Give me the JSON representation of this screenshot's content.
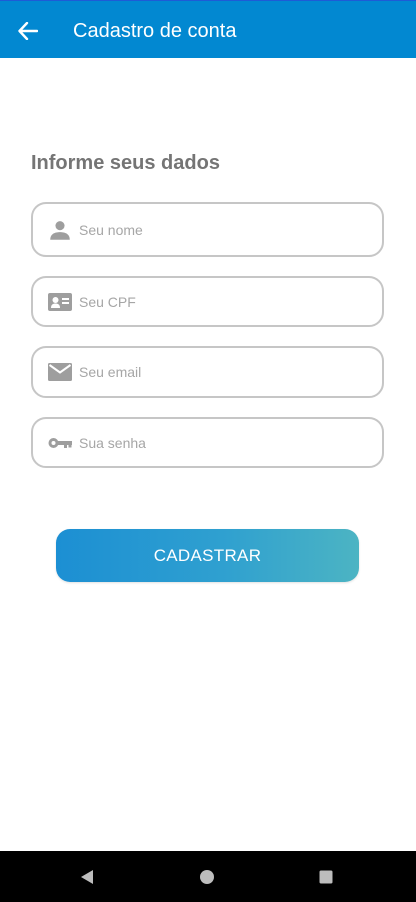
{
  "header": {
    "title": "Cadastro de conta",
    "back_icon": "arrow-left-icon",
    "color": "#0288d1"
  },
  "form": {
    "section_title": "Informe seus dados",
    "fields": [
      {
        "icon": "person-icon",
        "placeholder": "Seu nome",
        "value": ""
      },
      {
        "icon": "id-card-icon",
        "placeholder": "Seu CPF",
        "value": ""
      },
      {
        "icon": "email-icon",
        "placeholder": "Seu email",
        "value": ""
      },
      {
        "icon": "key-icon",
        "placeholder": "Sua senha",
        "value": ""
      }
    ],
    "submit_label": "CADASTRAR"
  },
  "system_nav": {
    "buttons": [
      "back-triangle-icon",
      "home-circle-icon",
      "recents-square-icon"
    ]
  }
}
